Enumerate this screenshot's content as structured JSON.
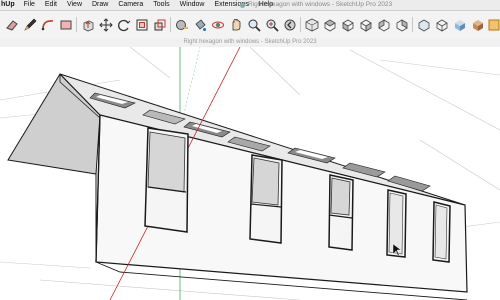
{
  "menubar": {
    "app_name": "hUp",
    "items": [
      "File",
      "Edit",
      "View",
      "Draw",
      "Camera",
      "Tools",
      "Window",
      "Extensions",
      "Help"
    ],
    "window_title": "Right hexagon with windows - SketchUp Pro 2023"
  },
  "toolbar": {
    "icons": [
      "eraser-icon",
      "pencil-icon",
      "arc-icon",
      "rectangle-icon",
      "pushpull-icon",
      "move-icon",
      "rotate-icon",
      "offset-icon",
      "scale-icon",
      "tape-measure-icon",
      "paint-bucket-icon",
      "orbit-icon",
      "pan-icon",
      "zoom-icon",
      "zoom-extents-icon",
      "previous-view-icon",
      "iso-view-icon",
      "top-view-icon",
      "front-view-icon",
      "right-view-icon",
      "back-view-icon",
      "left-view-icon",
      "xray-icon",
      "wireframe-icon",
      "shaded-icon",
      "textured-icon",
      "section-icon",
      "warehouse-icon",
      "extension-icon"
    ]
  },
  "subtitle": "Right hexagon with windows - SketchUp Pro 2023",
  "colors": {
    "axis_red": "#c42a2a",
    "axis_green": "#2e9e4a",
    "wall_face": "#f7f7f7",
    "shadow_face": "#c9c9c9",
    "window_glass": "#d4d4d4",
    "edge": "#1a1a1a"
  }
}
